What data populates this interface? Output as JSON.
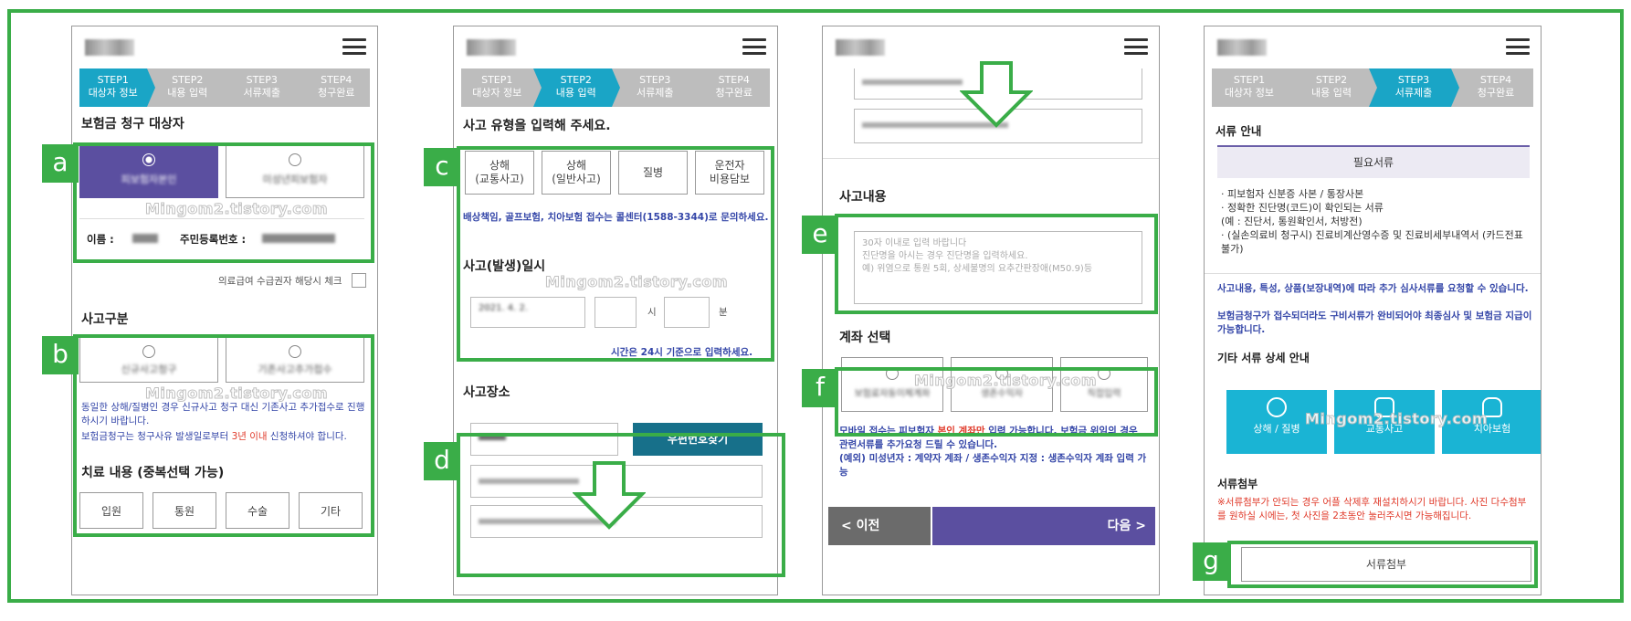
{
  "steps": [
    {
      "num": "STEP1",
      "label": "대상자 정보"
    },
    {
      "num": "STEP2",
      "label": "내용 입력"
    },
    {
      "num": "STEP3",
      "label": "서류제출"
    },
    {
      "num": "STEP4",
      "label": "청구완료"
    }
  ],
  "colors": {
    "highlight": "#3aad48",
    "step_active": "#1aa5c6",
    "selected": "#5b4fa0",
    "next_button": "#5b4fa0"
  },
  "watermark": "Mingom2.tistory.com",
  "labels": {
    "a": "a",
    "b": "b",
    "c": "c",
    "d": "d",
    "e": "e",
    "f": "f",
    "g": "g"
  },
  "panel1": {
    "title": "보험금 청구 대상자",
    "options": [
      "피보험자본인",
      "미성년피보험자"
    ],
    "name_label": "이름 :",
    "id_label": "주민등록번호 :",
    "medical_check": "의료급여 수급권자 해당시 체크",
    "accident_title": "사고구분",
    "accident_options": [
      "신규사고청구",
      "기존사고추가접수"
    ],
    "notice1": "동일한 상해/질병인 경우 신규사고 청구 대신 기존사고 추가접수로 진행하시기 바랍니다.",
    "notice2_a": "보험금청구는 청구사유 발생일로부터 ",
    "notice2_red": "3년 이내",
    "notice2_b": " 신청하셔야 합니다.",
    "treatment_title": "치료 내용 (중복선택 가능)",
    "treatments": [
      "입원",
      "통원",
      "수술",
      "기타"
    ]
  },
  "panel2": {
    "type_title": "사고 유형을 입력해 주세요.",
    "types": [
      {
        "l1": "상해",
        "l2": "(교통사고)"
      },
      {
        "l1": "상해",
        "l2": "(일반사고)"
      },
      {
        "l1": "질병",
        "l2": ""
      },
      {
        "l1": "운전자",
        "l2": "비용담보"
      }
    ],
    "type_notice": "배상책임, 골프보험, 치아보험 접수는 콜센터(1588-3344)로 문의하세요.",
    "date_title": "사고(발생)일시",
    "date_value": "2021. 4. 2.",
    "hour_unit": "시",
    "minute_unit": "분",
    "time_notice": "시간은 24시 기준으로 입력하세요.",
    "place_title": "사고장소",
    "zip_button": "우편번호찾기"
  },
  "panel3": {
    "content_title": "사고내용",
    "content_placeholder": [
      "30자 이내로 입력 바랍니다",
      "진단명을 아시는 경우 진단명을 입력하세요.",
      "예) 위염으로 통원 5회, 상세불명의 요추간판장애(M50.9)등"
    ],
    "account_title": "계좌 선택",
    "accounts": [
      "보험료자동이체계좌",
      "생존수익자",
      "직접입력"
    ],
    "notice_a": "모바일 접수는 피보험자 ",
    "notice_red": "본인 계좌만",
    "notice_b": " 입력 가능합니다. 보험금 위임의 경우 관련서류를 추가요청 드릴 수 있습니다.",
    "notice2": "(예외) 미성년자 : 계약자 계좌 / 생존수익자 지정 : 생존수익자 계좌 입력 가능",
    "prev": "< 이전",
    "next": "다음 >"
  },
  "panel4": {
    "guide_title": "서류 안내",
    "required": "필요서류",
    "docs": [
      "· 피보험자 신분증 사본 / 통장사본",
      "· 정확한 진단명(코드)이 확인되는 서류",
      "  (예 : 진단서, 통원확인서, 처방전)",
      "· (실손의료비 청구시) 진료비계산영수증 및 진료비세부내역서 (카드전표 불가)"
    ],
    "extra1": "사고내용, 특성, 상품(보장내역)에 따라 추가 심사서류를 요청할 수 있습니다.",
    "extra2": "보험금청구가 접수되더라도 구비서류가 완비되어야 최종심사 및 보험금 지급이 가능합니다.",
    "other_title": "기타 서류 상세 안내",
    "tiles": [
      "상해 / 질병",
      "교통사고",
      "치아보험"
    ],
    "attach_title": "서류첨부",
    "attach_notice": "※서류첨부가 안되는 경우 어플 삭제후 재설치하시기 바랍니다. 사진 다수첨부를 원하실 시에는, 첫 사진을 2초동안 눌러주시면 가능해집니다.",
    "attach_button": "서류첨부"
  }
}
